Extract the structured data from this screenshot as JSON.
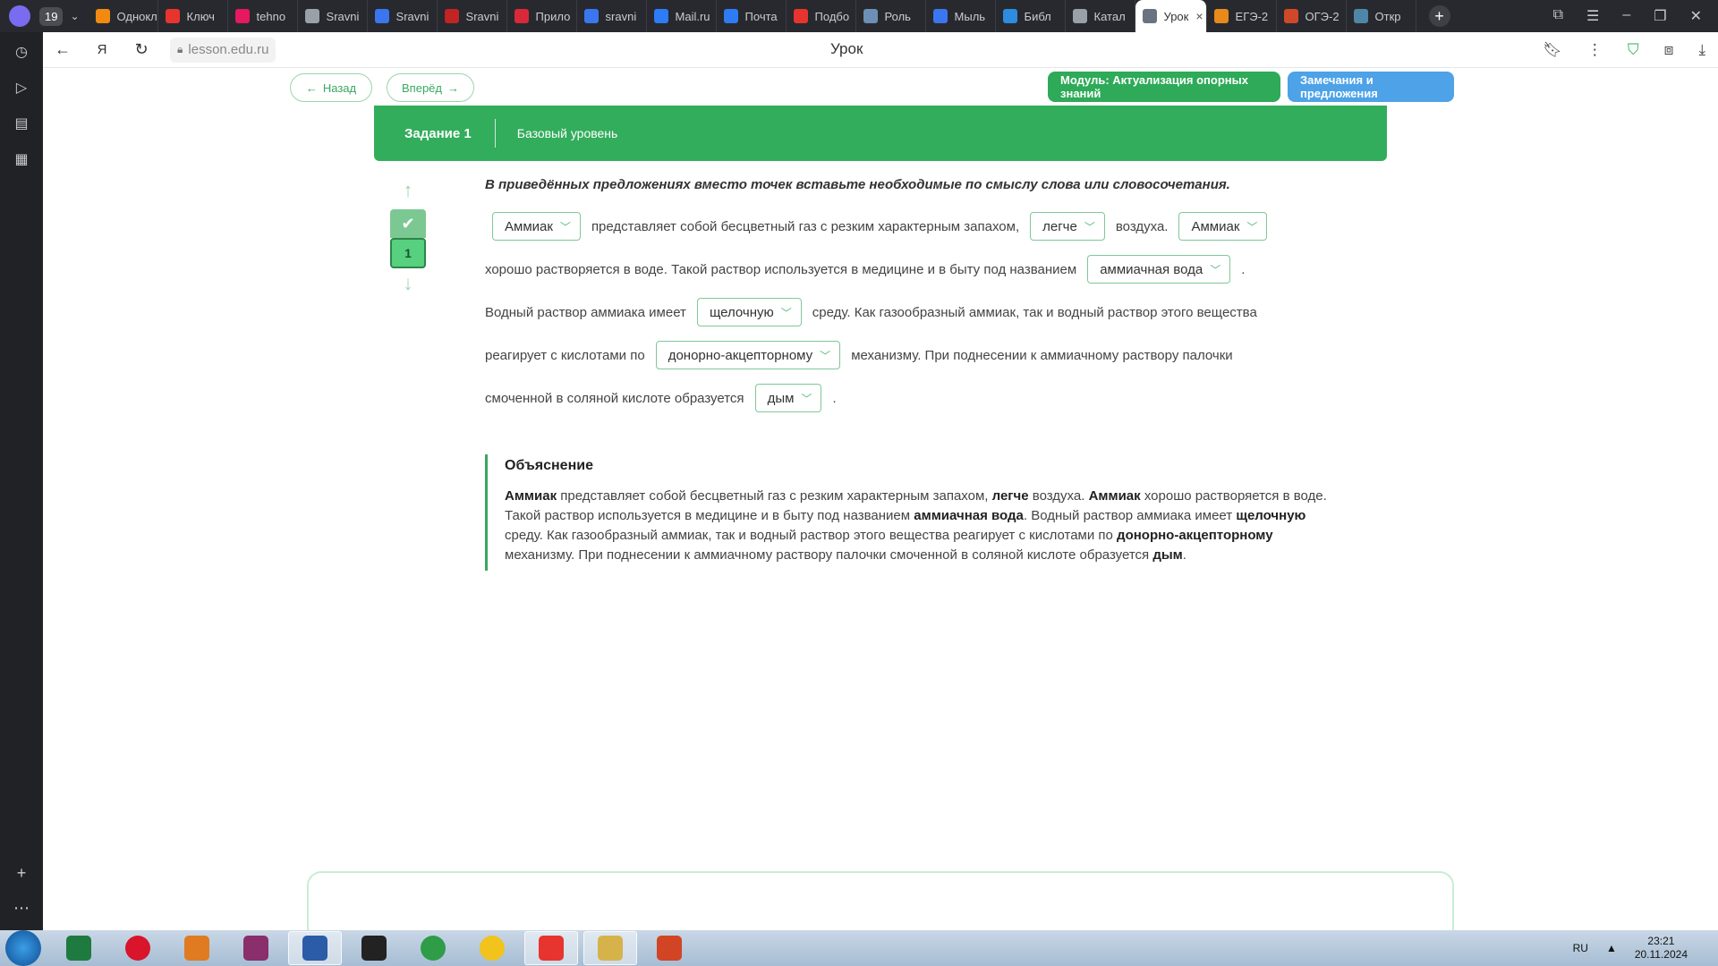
{
  "browser": {
    "tab_count": "19",
    "tabs": [
      {
        "label": "Одноклассники",
        "color": "#f28a12"
      },
      {
        "label": "Ключ",
        "color": "#e8342e"
      },
      {
        "label": "tehno",
        "color": "#e6185f"
      },
      {
        "label": "Sravni",
        "color": "#9aa0a8"
      },
      {
        "label": "Sravni",
        "color": "#3a76f0"
      },
      {
        "label": "Sravni",
        "color": "#c22323"
      },
      {
        "label": "Прило",
        "color": "#d8283a"
      },
      {
        "label": "sravni",
        "color": "#3a76f0"
      },
      {
        "label": "Mail.ru",
        "color": "#2d7bf5"
      },
      {
        "label": "Почта",
        "color": "#2d7bf5"
      },
      {
        "label": "Подбо",
        "color": "#e8342e"
      },
      {
        "label": "Роль",
        "color": "#6e8fb5"
      },
      {
        "label": "Мыль",
        "color": "#3a76f0"
      },
      {
        "label": "Библ",
        "color": "#2d8ce0"
      },
      {
        "label": "Катал",
        "color": "#9aa0a8"
      },
      {
        "label": "Урок",
        "color": "#6a7380",
        "active": true
      },
      {
        "label": "ЕГЭ-2",
        "color": "#e88a1a"
      },
      {
        "label": "ОГЭ-2",
        "color": "#d0482a"
      },
      {
        "label": "Откр",
        "color": "#4f86a8"
      }
    ],
    "close_tab": "×",
    "new_tab": "+",
    "url": "lesson.edu.ru",
    "page_title": "Урок"
  },
  "lesson": {
    "back_label": "Назад",
    "forward_label": "Вперёд",
    "module_label": "Модуль: Актуализация опорных знаний",
    "feedback_label": "Замечания и предложения",
    "task_title": "Задание 1",
    "task_level": "Базовый уровень",
    "question_number": "1",
    "instruction": "В приведённых предложениях вместо точек вставьте необходимые по смыслу слова или словосочетания.",
    "text": {
      "l1_a": "представляет собой бесцветный газ с резким характерным запахом,",
      "l1_b": "воздуха.",
      "l2_a": "хорошо растворяется в воде. Такой раствор используется в медицине и в быту под названием",
      "l2_b": ".",
      "l3_a": "Водный раствор аммиака имеет",
      "l3_b": "среду. Как газообразный аммиак, так и водный раствор этого вещества",
      "l4_a": "реагирует с кислотами по",
      "l4_b": "механизму. При поднесении к аммиачному раствору палочки",
      "l5_a": "смоченной в соляной кислоте образуется",
      "l5_b": "."
    },
    "dropdowns": {
      "d1": "Аммиак",
      "d2": "легче",
      "d3": "Аммиак",
      "d4": "аммиачная вода",
      "d5": "щелочную",
      "d6": "донорно-акцепторному",
      "d7": "дым"
    },
    "explanation": {
      "title": "Объяснение",
      "b1": "Аммиак",
      "t1": " представляет собой бесцветный газ с резким характерным запахом, ",
      "b2": "легче",
      "t2": " воздуха. ",
      "b3": "Аммиак",
      "t3": " хорошо растворяется в воде. Такой раствор используется в медицине и в быту под названием ",
      "b4": "аммиачная вода",
      "t4": ". Водный раствор аммиака имеет ",
      "b5": "щелочную",
      "t5": " среду. Как газообразный аммиак, так и водный раствор этого вещества реагирует с кислотами по ",
      "b6": "донорно-акцепторному",
      "t6": " механизму. При поднесении к аммиачному раствору палочки смоченной в соляной кислоте образуется ",
      "b7": "дым",
      "t7": "."
    },
    "colors": {
      "green": "#32ad5b",
      "module_green": "#2eaa58",
      "feedback_blue": "#4da2e8"
    }
  },
  "taskbar": {
    "apps": [
      {
        "name": "excel",
        "color": "#1f7a3f"
      },
      {
        "name": "opera",
        "color": "#d8152b"
      },
      {
        "name": "office",
        "color": "#e07b22"
      },
      {
        "name": "winrar",
        "color": "#8a2e6c"
      },
      {
        "name": "word",
        "color": "#2a5ca8"
      },
      {
        "name": "video",
        "color": "#222222"
      },
      {
        "name": "chrome",
        "color": "#2f9c48"
      },
      {
        "name": "smiley",
        "color": "#f2c31a"
      },
      {
        "name": "yandex",
        "color": "#e8342e"
      },
      {
        "name": "explorer",
        "color": "#d6b34a"
      },
      {
        "name": "presentation",
        "color": "#d14524"
      }
    ],
    "lang": "RU",
    "time": "23:21",
    "date": "20.11.2024"
  }
}
